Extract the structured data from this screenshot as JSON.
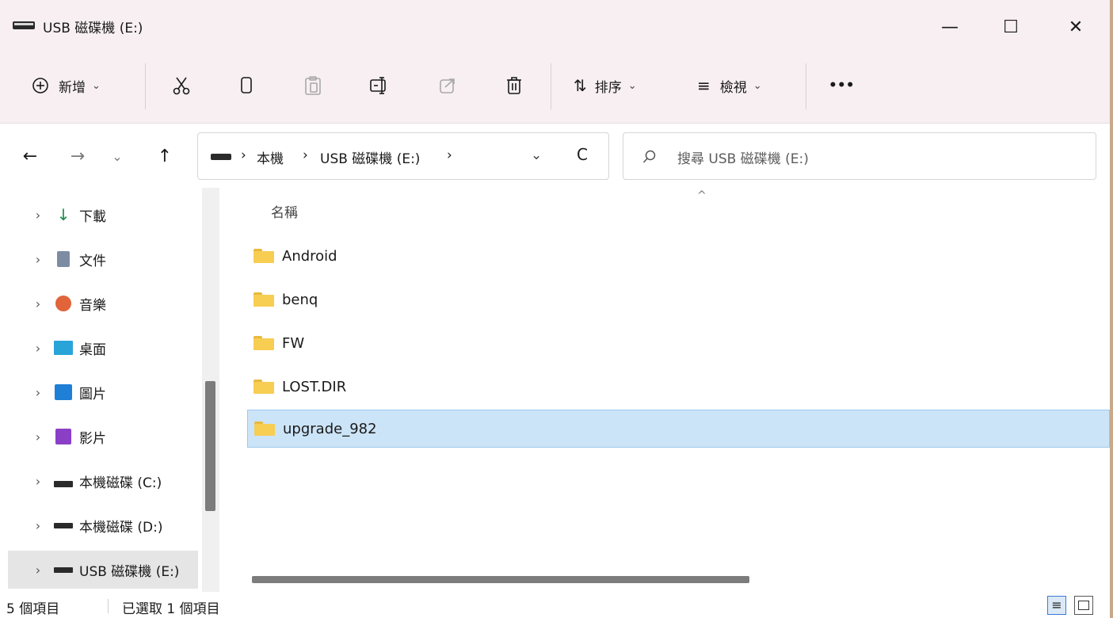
{
  "window": {
    "title": "USB 磁碟機 (E:)",
    "controls": {
      "minimize": "—",
      "maximize": "☐",
      "close": "✕"
    }
  },
  "ribbon": {
    "new_label": "新增",
    "sort_label": "排序",
    "view_label": "檢視",
    "more_label": "•••"
  },
  "nav": {
    "back": "←",
    "forward": "→",
    "recent": "⌄",
    "up": "↑",
    "breadcrumb": [
      "本機",
      "USB 磁碟機 (E:)"
    ],
    "refresh": "C",
    "search_placeholder": "搜尋 USB 磁碟機 (E:)"
  },
  "sidebar": {
    "items": [
      {
        "label": "下載",
        "icon": "download-icon"
      },
      {
        "label": "文件",
        "icon": "documents-icon"
      },
      {
        "label": "音樂",
        "icon": "music-icon"
      },
      {
        "label": "桌面",
        "icon": "desktop-icon"
      },
      {
        "label": "圖片",
        "icon": "pictures-icon"
      },
      {
        "label": "影片",
        "icon": "videos-icon"
      },
      {
        "label": "本機磁碟 (C:)",
        "icon": "system-drive-icon"
      },
      {
        "label": "本機磁碟 (D:)",
        "icon": "drive-icon"
      },
      {
        "label": "USB 磁碟機 (E:)",
        "icon": "usb-drive-icon",
        "active": true
      }
    ]
  },
  "files": {
    "column_name": "名稱",
    "sort_indicator": "^",
    "rows": [
      {
        "name": "Android",
        "type": "folder"
      },
      {
        "name": "benq",
        "type": "folder"
      },
      {
        "name": "FW",
        "type": "folder"
      },
      {
        "name": "LOST.DIR",
        "type": "folder"
      },
      {
        "name": "upgrade_982",
        "type": "folder",
        "selected": true
      }
    ]
  },
  "status": {
    "count": "5 個項目",
    "selected": "已選取 1 個項目"
  },
  "colors": {
    "chrome_bg": "#f7eff1",
    "selection": "#cce4f7",
    "folder": "#f7cd52"
  }
}
